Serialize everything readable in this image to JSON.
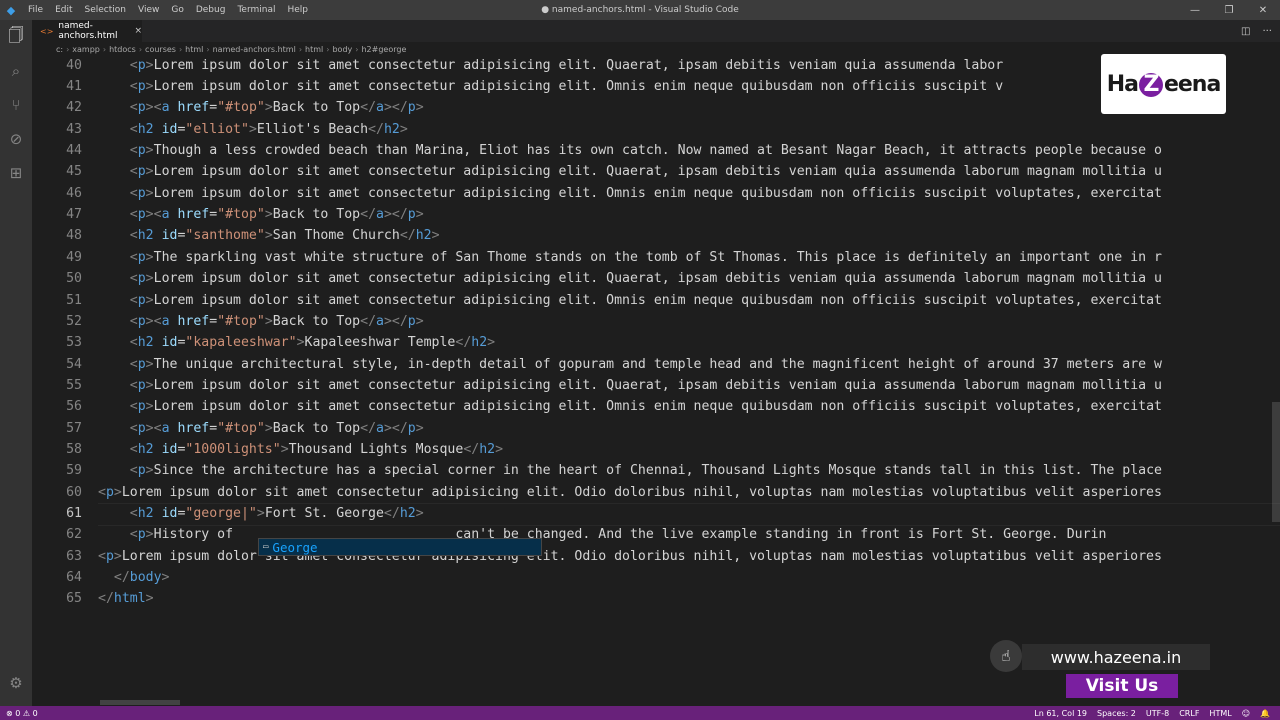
{
  "window": {
    "title": "● named-anchors.html - Visual Studio Code",
    "menu": [
      "File",
      "Edit",
      "Selection",
      "View",
      "Go",
      "Debug",
      "Terminal",
      "Help"
    ]
  },
  "tab": {
    "label": "named-anchors.html",
    "icon": "html-file-icon"
  },
  "breadcrumb": [
    "c:",
    "xampp",
    "htdocs",
    "courses",
    "html",
    "named-anchors.html",
    "html",
    "body",
    "h2#george"
  ],
  "editor": {
    "current_line": 61,
    "lines": [
      {
        "n": "40",
        "tokens": [
          [
            "t",
            "    "
          ],
          [
            "br",
            "<"
          ],
          [
            "tg",
            "p"
          ],
          [
            "br",
            ">"
          ],
          [
            "t",
            "Lorem ipsum dolor sit amet consectetur adipisicing elit. Quaerat, ipsam debitis veniam quia assumenda labor"
          ]
        ]
      },
      {
        "n": "41",
        "tokens": [
          [
            "t",
            "    "
          ],
          [
            "br",
            "<"
          ],
          [
            "tg",
            "p"
          ],
          [
            "br",
            ">"
          ],
          [
            "t",
            "Lorem ipsum dolor sit amet consectetur adipisicing elit. Omnis enim neque quibusdam non officiis suscipit v"
          ]
        ]
      },
      {
        "n": "42",
        "tokens": [
          [
            "t",
            "    "
          ],
          [
            "br",
            "<"
          ],
          [
            "tg",
            "p"
          ],
          [
            "br",
            "><"
          ],
          [
            "tg",
            "a"
          ],
          [
            "t",
            " "
          ],
          [
            "at",
            "href"
          ],
          [
            "t",
            "="
          ],
          [
            "sv",
            "\"#top\""
          ],
          [
            "br",
            ">"
          ],
          [
            "t",
            "Back to Top"
          ],
          [
            "br",
            "</"
          ],
          [
            "tg",
            "a"
          ],
          [
            "br",
            "></"
          ],
          [
            "tg",
            "p"
          ],
          [
            "br",
            ">"
          ]
        ]
      },
      {
        "n": "43",
        "tokens": [
          [
            "t",
            "    "
          ],
          [
            "br",
            "<"
          ],
          [
            "tg",
            "h2"
          ],
          [
            "t",
            " "
          ],
          [
            "at",
            "id"
          ],
          [
            "t",
            "="
          ],
          [
            "sv",
            "\"elliot\""
          ],
          [
            "br",
            ">"
          ],
          [
            "t",
            "Elliot's Beach"
          ],
          [
            "br",
            "</"
          ],
          [
            "tg",
            "h2"
          ],
          [
            "br",
            ">"
          ]
        ]
      },
      {
        "n": "44",
        "tokens": [
          [
            "t",
            "    "
          ],
          [
            "br",
            "<"
          ],
          [
            "tg",
            "p"
          ],
          [
            "br",
            ">"
          ],
          [
            "t",
            "Though a less crowded beach than Marina, Eliot has its own catch. Now named at Besant Nagar Beach, it attracts people because o"
          ]
        ]
      },
      {
        "n": "45",
        "tokens": [
          [
            "t",
            "    "
          ],
          [
            "br",
            "<"
          ],
          [
            "tg",
            "p"
          ],
          [
            "br",
            ">"
          ],
          [
            "t",
            "Lorem ipsum dolor sit amet consectetur adipisicing elit. Quaerat, ipsam debitis veniam quia assumenda laborum magnam mollitia u"
          ]
        ]
      },
      {
        "n": "46",
        "tokens": [
          [
            "t",
            "    "
          ],
          [
            "br",
            "<"
          ],
          [
            "tg",
            "p"
          ],
          [
            "br",
            ">"
          ],
          [
            "t",
            "Lorem ipsum dolor sit amet consectetur adipisicing elit. Omnis enim neque quibusdam non officiis suscipit voluptates, exercitat"
          ]
        ]
      },
      {
        "n": "47",
        "tokens": [
          [
            "t",
            "    "
          ],
          [
            "br",
            "<"
          ],
          [
            "tg",
            "p"
          ],
          [
            "br",
            "><"
          ],
          [
            "tg",
            "a"
          ],
          [
            "t",
            " "
          ],
          [
            "at",
            "href"
          ],
          [
            "t",
            "="
          ],
          [
            "sv",
            "\"#top\""
          ],
          [
            "br",
            ">"
          ],
          [
            "t",
            "Back to Top"
          ],
          [
            "br",
            "</"
          ],
          [
            "tg",
            "a"
          ],
          [
            "br",
            "></"
          ],
          [
            "tg",
            "p"
          ],
          [
            "br",
            ">"
          ]
        ]
      },
      {
        "n": "48",
        "tokens": [
          [
            "t",
            "    "
          ],
          [
            "br",
            "<"
          ],
          [
            "tg",
            "h2"
          ],
          [
            "t",
            " "
          ],
          [
            "at",
            "id"
          ],
          [
            "t",
            "="
          ],
          [
            "sv",
            "\"santhome\""
          ],
          [
            "br",
            ">"
          ],
          [
            "t",
            "San Thome Church"
          ],
          [
            "br",
            "</"
          ],
          [
            "tg",
            "h2"
          ],
          [
            "br",
            ">"
          ]
        ]
      },
      {
        "n": "49",
        "tokens": [
          [
            "t",
            "    "
          ],
          [
            "br",
            "<"
          ],
          [
            "tg",
            "p"
          ],
          [
            "br",
            ">"
          ],
          [
            "t",
            "The sparkling vast white structure of San Thome stands on the tomb of St Thomas. This place is definitely an important one in r"
          ]
        ]
      },
      {
        "n": "50",
        "tokens": [
          [
            "t",
            "    "
          ],
          [
            "br",
            "<"
          ],
          [
            "tg",
            "p"
          ],
          [
            "br",
            ">"
          ],
          [
            "t",
            "Lorem ipsum dolor sit amet consectetur adipisicing elit. Quaerat, ipsam debitis veniam quia assumenda laborum magnam mollitia u"
          ]
        ]
      },
      {
        "n": "51",
        "tokens": [
          [
            "t",
            "    "
          ],
          [
            "br",
            "<"
          ],
          [
            "tg",
            "p"
          ],
          [
            "br",
            ">"
          ],
          [
            "t",
            "Lorem ipsum dolor sit amet consectetur adipisicing elit. Omnis enim neque quibusdam non officiis suscipit voluptates, exercitat"
          ]
        ]
      },
      {
        "n": "52",
        "tokens": [
          [
            "t",
            "    "
          ],
          [
            "br",
            "<"
          ],
          [
            "tg",
            "p"
          ],
          [
            "br",
            "><"
          ],
          [
            "tg",
            "a"
          ],
          [
            "t",
            " "
          ],
          [
            "at",
            "href"
          ],
          [
            "t",
            "="
          ],
          [
            "sv",
            "\"#top\""
          ],
          [
            "br",
            ">"
          ],
          [
            "t",
            "Back to Top"
          ],
          [
            "br",
            "</"
          ],
          [
            "tg",
            "a"
          ],
          [
            "br",
            "></"
          ],
          [
            "tg",
            "p"
          ],
          [
            "br",
            ">"
          ]
        ]
      },
      {
        "n": "53",
        "tokens": [
          [
            "t",
            "    "
          ],
          [
            "br",
            "<"
          ],
          [
            "tg",
            "h2"
          ],
          [
            "t",
            " "
          ],
          [
            "at",
            "id"
          ],
          [
            "t",
            "="
          ],
          [
            "sv",
            "\"kapaleeshwar\""
          ],
          [
            "br",
            ">"
          ],
          [
            "t",
            "Kapaleeshwar Temple"
          ],
          [
            "br",
            "</"
          ],
          [
            "tg",
            "h2"
          ],
          [
            "br",
            ">"
          ]
        ]
      },
      {
        "n": "54",
        "tokens": [
          [
            "t",
            "    "
          ],
          [
            "br",
            "<"
          ],
          [
            "tg",
            "p"
          ],
          [
            "br",
            ">"
          ],
          [
            "t",
            "The unique architectural style, in-depth detail of gopuram and temple head and the magnificent height of around 37 meters are w"
          ]
        ]
      },
      {
        "n": "55",
        "tokens": [
          [
            "t",
            "    "
          ],
          [
            "br",
            "<"
          ],
          [
            "tg",
            "p"
          ],
          [
            "br",
            ">"
          ],
          [
            "t",
            "Lorem ipsum dolor sit amet consectetur adipisicing elit. Quaerat, ipsam debitis veniam quia assumenda laborum magnam mollitia u"
          ]
        ]
      },
      {
        "n": "56",
        "tokens": [
          [
            "t",
            "    "
          ],
          [
            "br",
            "<"
          ],
          [
            "tg",
            "p"
          ],
          [
            "br",
            ">"
          ],
          [
            "t",
            "Lorem ipsum dolor sit amet consectetur adipisicing elit. Omnis enim neque quibusdam non officiis suscipit voluptates, exercitat"
          ]
        ]
      },
      {
        "n": "57",
        "tokens": [
          [
            "t",
            "    "
          ],
          [
            "br",
            "<"
          ],
          [
            "tg",
            "p"
          ],
          [
            "br",
            "><"
          ],
          [
            "tg",
            "a"
          ],
          [
            "t",
            " "
          ],
          [
            "at",
            "href"
          ],
          [
            "t",
            "="
          ],
          [
            "sv",
            "\"#top\""
          ],
          [
            "br",
            ">"
          ],
          [
            "t",
            "Back to Top"
          ],
          [
            "br",
            "</"
          ],
          [
            "tg",
            "a"
          ],
          [
            "br",
            "></"
          ],
          [
            "tg",
            "p"
          ],
          [
            "br",
            ">"
          ]
        ]
      },
      {
        "n": "58",
        "tokens": [
          [
            "t",
            "    "
          ],
          [
            "br",
            "<"
          ],
          [
            "tg",
            "h2"
          ],
          [
            "t",
            " "
          ],
          [
            "at",
            "id"
          ],
          [
            "t",
            "="
          ],
          [
            "sv",
            "\"1000lights\""
          ],
          [
            "br",
            ">"
          ],
          [
            "t",
            "Thousand Lights Mosque"
          ],
          [
            "br",
            "</"
          ],
          [
            "tg",
            "h2"
          ],
          [
            "br",
            ">"
          ]
        ]
      },
      {
        "n": "59",
        "tokens": [
          [
            "t",
            "    "
          ],
          [
            "br",
            "<"
          ],
          [
            "tg",
            "p"
          ],
          [
            "br",
            ">"
          ],
          [
            "t",
            "Since the architecture has a special corner in the heart of Chennai, Thousand Lights Mosque stands tall in this list. The place"
          ]
        ]
      },
      {
        "n": "60",
        "tokens": [
          [
            "br",
            "<"
          ],
          [
            "tg",
            "p"
          ],
          [
            "br",
            ">"
          ],
          [
            "t",
            "Lorem ipsum dolor sit amet consectetur adipisicing elit. Odio doloribus nihil, voluptas nam molestias voluptatibus velit asperiores"
          ]
        ]
      },
      {
        "n": "61",
        "tokens": [
          [
            "t",
            "    "
          ],
          [
            "br",
            "<"
          ],
          [
            "tg",
            "h2"
          ],
          [
            "t",
            " "
          ],
          [
            "at",
            "id"
          ],
          [
            "t",
            "="
          ],
          [
            "sv",
            "\"george|\""
          ],
          [
            "br",
            ">"
          ],
          [
            "t",
            "Fort St. George"
          ],
          [
            "br",
            "</"
          ],
          [
            "tg",
            "h2"
          ],
          [
            "br",
            ">"
          ]
        ]
      },
      {
        "n": "62",
        "tokens": [
          [
            "t",
            "    "
          ],
          [
            "br",
            "<"
          ],
          [
            "tg",
            "p"
          ],
          [
            "br",
            ">"
          ],
          [
            "t",
            "History of "
          ],
          [
            "t",
            "                           "
          ],
          [
            "t",
            "can't be changed. And the live example standing in front is Fort St. George. Durin"
          ]
        ]
      },
      {
        "n": "63",
        "tokens": [
          [
            "br",
            "<"
          ],
          [
            "tg",
            "p"
          ],
          [
            "br",
            ">"
          ],
          [
            "t",
            "Lorem ipsum dolor sit amet consectetur adipisicing elit. Odio doloribus nihil, voluptas nam molestias voluptatibus velit asperiores"
          ]
        ]
      },
      {
        "n": "64",
        "tokens": [
          [
            "t",
            "  "
          ],
          [
            "br",
            "</"
          ],
          [
            "tg",
            "body"
          ],
          [
            "br",
            ">"
          ]
        ]
      },
      {
        "n": "65",
        "tokens": [
          [
            "br",
            "</"
          ],
          [
            "tg",
            "html"
          ],
          [
            "br",
            ">"
          ]
        ]
      }
    ],
    "suggestion": {
      "icon": "abc-word-icon",
      "text": "George"
    }
  },
  "statusbar": {
    "left": "⊗ 0  ⚠ 0",
    "items": [
      "Ln 61, Col 19",
      "Spaces: 2",
      "UTF-8",
      "CRLF",
      "HTML",
      "☺",
      "🔔"
    ],
    "bg_color": "#68217a"
  },
  "watermark": {
    "logo_text_a": "Ha",
    "logo_mark": "Z",
    "logo_text_b": "eena",
    "promo_url": "www.hazeena.in",
    "promo_visit": "Visit Us"
  }
}
